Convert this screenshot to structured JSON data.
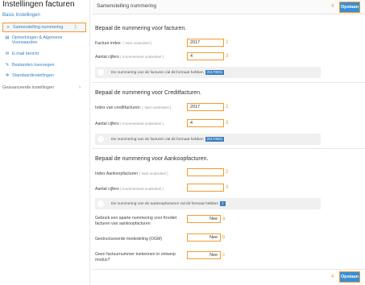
{
  "sidebar": {
    "title": "Instellingen facturen",
    "section_link": "Basis Instellingen",
    "items": [
      {
        "icon": "list-icon",
        "glyph": "≡",
        "label": "Samenstelling nummering"
      },
      {
        "icon": "edit-icon",
        "glyph": "▤",
        "label": "Opmerkingen & Algemene Voorwaarden"
      },
      {
        "icon": "mail-icon",
        "glyph": "✉",
        "label": "E-mail bericht"
      },
      {
        "icon": "paperclip-icon",
        "glyph": "✎",
        "label": "Bestanden toevoegen"
      },
      {
        "icon": "gear-icon",
        "glyph": "✲",
        "label": "Standaardinstellingen"
      },
      {
        "icon": "",
        "glyph": "",
        "label": "Geavanceerde instellingen"
      }
    ]
  },
  "header": {
    "title": "Samenstelling nummering",
    "save_label": "Opslaan",
    "callout": "4"
  },
  "callouts": {
    "sidebar": "1",
    "a": "2",
    "b": "3",
    "c": "2",
    "d": "3",
    "e": "2",
    "f": "3",
    "g": "a",
    "h": "b",
    "i": "c",
    "bottom": "4"
  },
  "facturen": {
    "title": "Bepaal de nummering voor facturen.",
    "index_label": "Factuur index:",
    "index_hint": "( Vast onderdeel )",
    "index_value": "2017",
    "digits_label": "Aantal cijfers",
    "digits_hint": "( Incrementeel onderdeel )",
    "digits_value": "4",
    "note": "De nummering van de facturen zal dit formaat hebben",
    "note_badge": "20170001"
  },
  "credit": {
    "title": "Bepaal de nummering voor Creditfacturen.",
    "index_label": "Index van creditfacturen:",
    "index_hint": "( Vast onderdeel )",
    "index_value": "2017",
    "digits_label": "Aantal cijfers",
    "digits_hint": "( Incrementeel onderdeel )",
    "digits_value": "4",
    "note": "De nummering van de facturen zal dit formaat hebben",
    "note_badge": "20170001"
  },
  "aankoop": {
    "title": "Bepaal de nummering voor Aankoopfacturen.",
    "index_label": "Index Aankoopfacturen",
    "index_hint": "( Vast onderdeel )",
    "index_value": "",
    "digits_label": "Aantal cijfers",
    "digits_hint": "( Incrementeel onderdeel )",
    "digits_value": "",
    "note": "De nummering van de aankoopfacturen zal dit formaat hebben",
    "note_badge": "1"
  },
  "options": [
    {
      "label": "Gebruik een aparte nummering voor Krediet facturen van aankoopfacturen",
      "value": "Nee"
    },
    {
      "label": "Gestructureerde mededeling (OGM)",
      "value": "Nee"
    },
    {
      "label": "Geen factuurnummer toekennen in ontwerp modus?",
      "value": "Nee"
    }
  ]
}
